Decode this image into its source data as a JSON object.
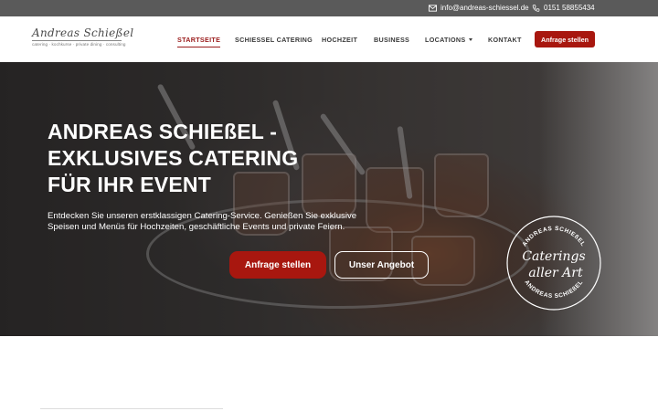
{
  "contact": {
    "email": "info@andreas-schiessel.de",
    "phone": "0151 58855434",
    "email_icon": "envelope-icon",
    "phone_icon": "phone-icon"
  },
  "logo": {
    "name": "Andreas Schießel",
    "tagline": "catering · kochkurse · private dining · consulting"
  },
  "nav": {
    "items": [
      {
        "label": "STARTSEITE",
        "active": true
      },
      {
        "label": "SCHIESSEL CATERING"
      },
      {
        "label": "HOCHZEIT"
      },
      {
        "label": "BUSINESS"
      },
      {
        "label": "LOCATIONS",
        "dropdown": true
      },
      {
        "label": "KONTAKT"
      }
    ],
    "cta": "Anfrage stellen"
  },
  "hero": {
    "title_lines": [
      "ANDREAS SCHIEßEL -",
      "EXKLUSIVES CATERING",
      "FÜR IHR EVENT"
    ],
    "text": "Entdecken Sie unseren erstklassigen Catering-Service. Genießen Sie exklusive Speisen und Menüs für Hochzeiten, geschäftliche Events und private Feiern.",
    "primary_button": "Anfrage stellen",
    "secondary_button": "Unser Angebot",
    "stamp": {
      "top_text": "ANDREAS SCHIEßEL",
      "line1": "Caterings",
      "line2": "aller Art",
      "bottom_text": "ANDREAS SCHIEßEL"
    }
  },
  "colors": {
    "accent": "#a8170f",
    "topbar": "#5a5a5a",
    "nav_active": "#9a1b1b"
  }
}
